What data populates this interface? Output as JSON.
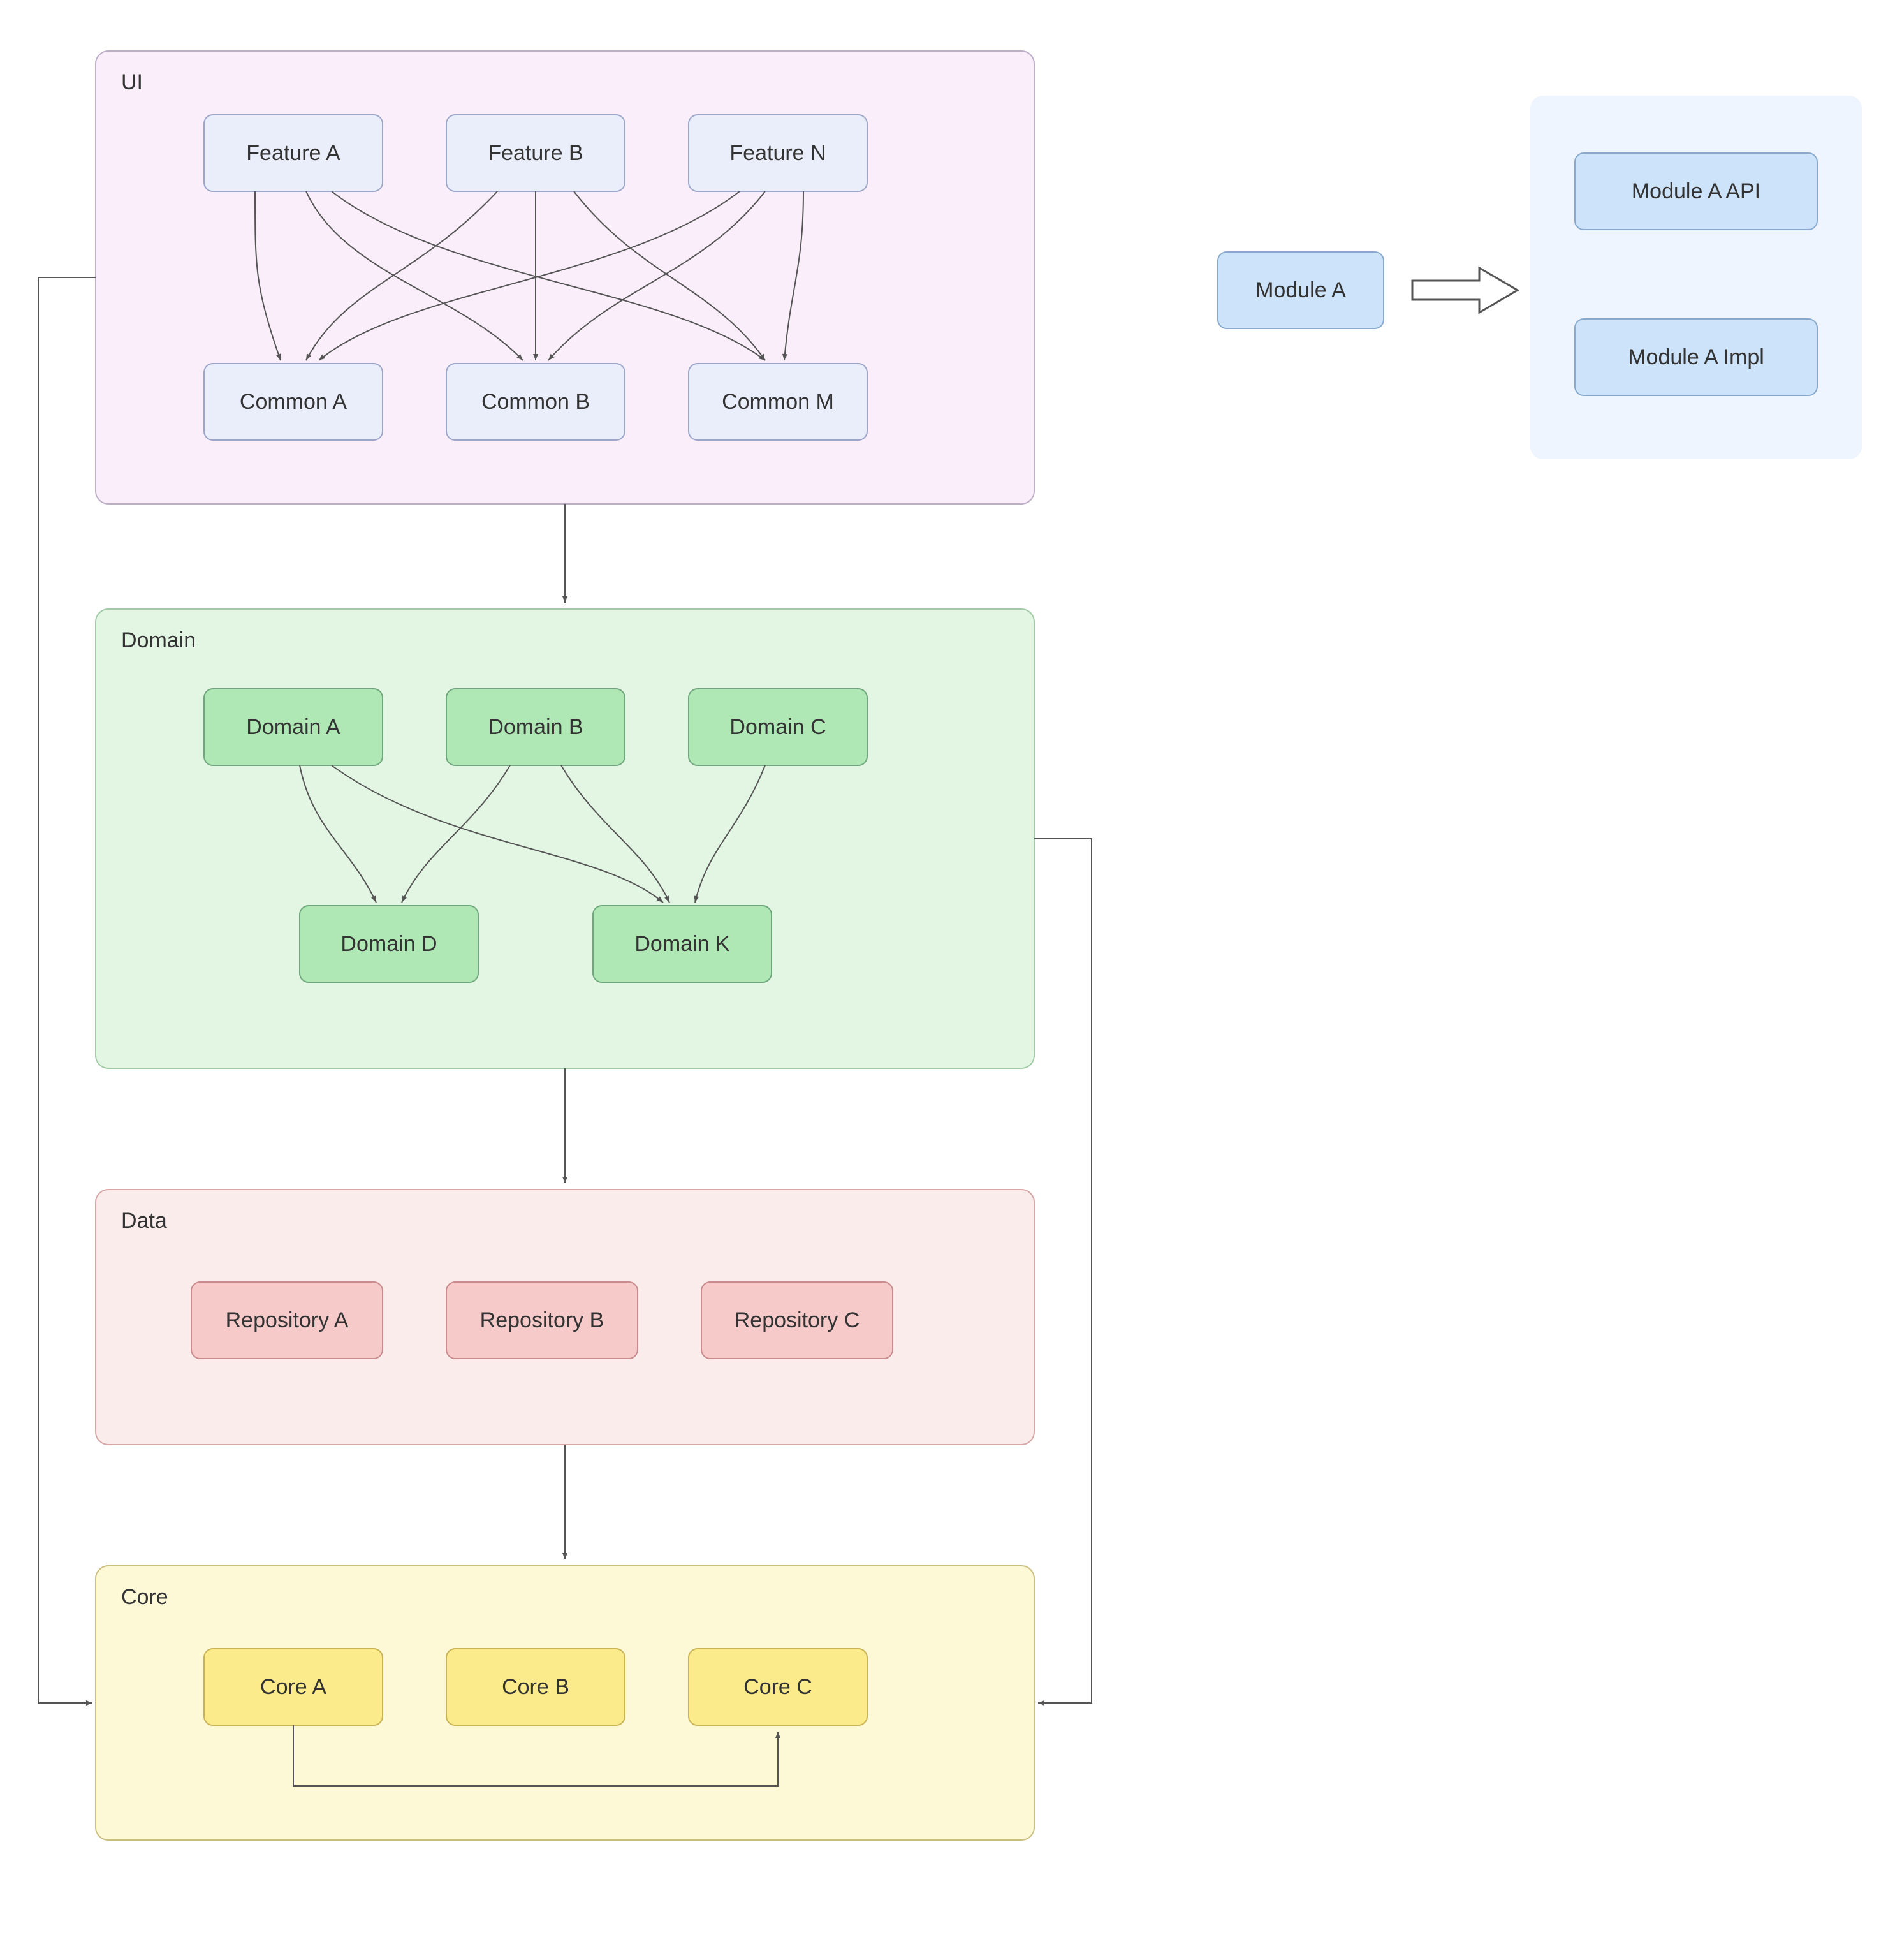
{
  "colors": {
    "ui_fill": "#f9eef9",
    "ui_stroke": "#bdaec8",
    "ui_node_fill": "#eaeefb",
    "ui_node_stroke": "#9ca6c9",
    "domain_fill": "#e3f6e4",
    "domain_stroke": "#a2c9a6",
    "domain_node_fill": "#b0e8b5",
    "domain_node_stroke": "#6fa77c",
    "data_fill": "#fbecec",
    "data_stroke": "#d7a6a6",
    "data_node_fill": "#f7caca",
    "data_node_stroke": "#c98b8b",
    "core_fill": "#fdf8d6",
    "core_stroke": "#c9be80",
    "core_node_fill": "#fbeb8a",
    "core_node_stroke": "#c9b357",
    "side_panel_fill": "#eef5fe",
    "side_node_fill": "#cde3f9",
    "side_node_stroke": "#88a9cd",
    "arrow_hollow_stroke": "#555555"
  },
  "layers": {
    "ui": {
      "title": "UI",
      "features": [
        "Feature A",
        "Feature B",
        "Feature N"
      ],
      "commons": [
        "Common A",
        "Common B",
        "Common M"
      ]
    },
    "domain": {
      "title": "Domain",
      "top": [
        "Domain A",
        "Domain B",
        "Domain C"
      ],
      "bottom": [
        "Domain D",
        "Domain K"
      ]
    },
    "data": {
      "title": "Data",
      "repos": [
        "Repository A",
        "Repository B",
        "Repository C"
      ]
    },
    "core": {
      "title": "Core",
      "cores": [
        "Core A",
        "Core B",
        "Core C"
      ]
    }
  },
  "side": {
    "source": "Module A",
    "targets": [
      "Module A API",
      "Module A Impl"
    ]
  }
}
